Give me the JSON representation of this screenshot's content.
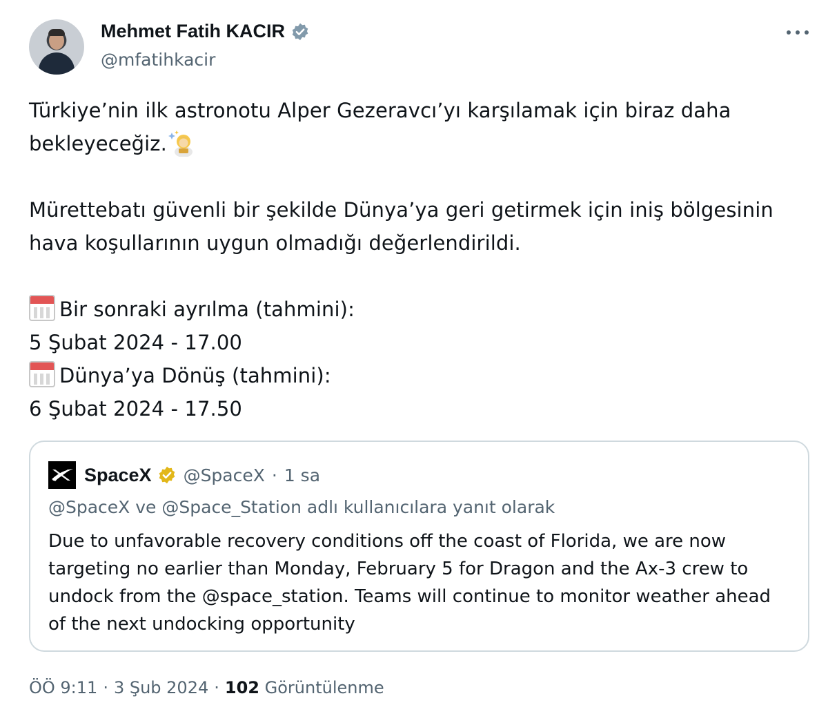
{
  "author": {
    "display_name": "Mehmet Fatih KACIR",
    "handle": "@mfatihkacir",
    "verified_icon": "verified-badge-icon",
    "verified_color": "#829aab"
  },
  "tweet": {
    "lines": [
      "Türkiye’nin ilk astronotu Alper Gezeravcı’yı karşılamak için biraz daha",
      "bekleyeceğiz.",
      "Mürettebatı güvenli bir şekilde Dünya’ya geri getirmek için iniş bölgesinin",
      "hava koşullarının uygun olmadığı değerlendirildi.",
      "Bir sonraki ayrılma (tahmini):",
      "5 Şubat 2024 - 17.00",
      "Dünya’ya Dönüş (tahmini):",
      "6 Şubat 2024 - 17.50"
    ],
    "emoji": {
      "line2": "astronaut-sparkles-icon",
      "calendar": "calendar-icon"
    }
  },
  "quote": {
    "display_name": "SpaceX",
    "handle": "@SpaceX",
    "separator": "·",
    "time": "1 sa",
    "verified_color": "#e2b719",
    "reply_context": "@SpaceX ve @Space_Station adlı kullanıcılara yanıt olarak",
    "lines": [
      "Due to unfavorable recovery conditions off the coast of Florida, we are now",
      "targeting no earlier than Monday, February 5 for Dragon and the Ax-3 crew to",
      "undock from the @space_station. Teams will continue to monitor weather ahead",
      "of the next undocking opportunity"
    ]
  },
  "meta": {
    "time": "ÖÖ 9:11",
    "sep1": "·",
    "date": "3 Şub 2024",
    "sep2": "·",
    "views": "102",
    "views_label": "Görüntülenme"
  }
}
